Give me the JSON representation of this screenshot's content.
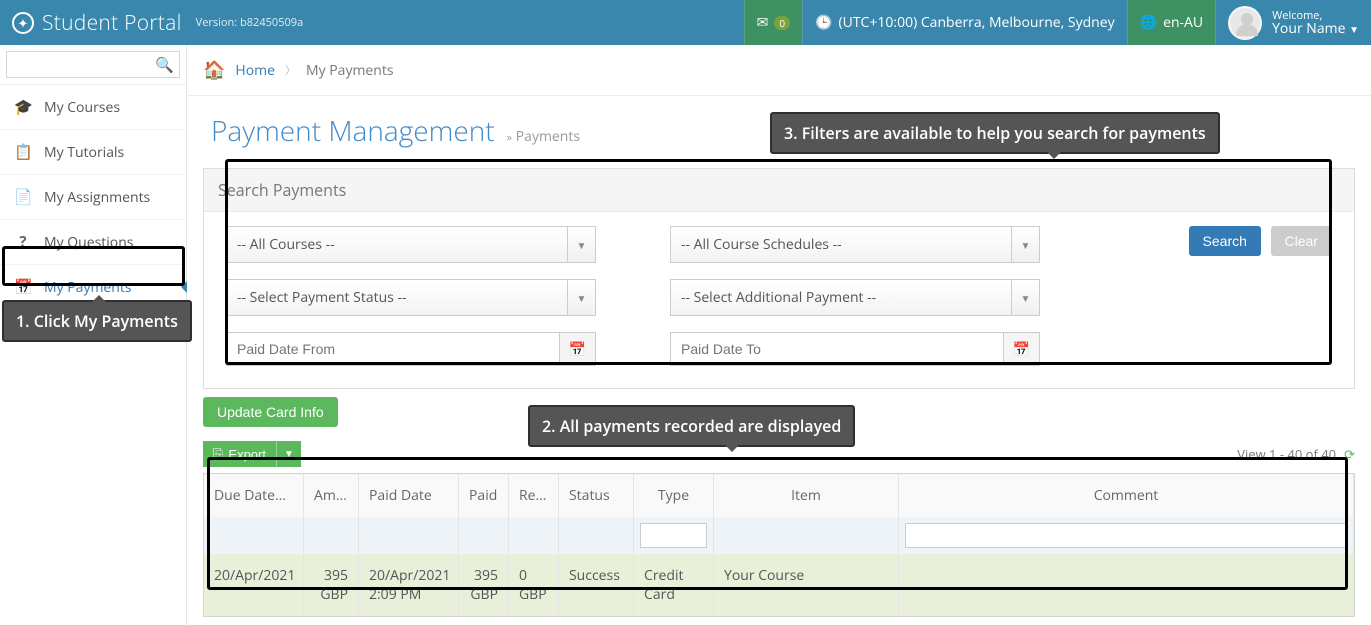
{
  "topbar": {
    "brand": "Student Portal",
    "version": "Version: b82450509a",
    "mail_badge": "0",
    "timezone": "(UTC+10:00) Canberra, Melbourne, Sydney",
    "locale": "en-AU",
    "welcome_label": "Welcome,",
    "user_name": "Your Name"
  },
  "sidebar": {
    "search_placeholder": "",
    "items": [
      {
        "label": "My Courses"
      },
      {
        "label": "My Tutorials"
      },
      {
        "label": "My Assignments"
      },
      {
        "label": "My Questions"
      },
      {
        "label": "My Payments"
      }
    ]
  },
  "crumbs": {
    "home": "Home",
    "current": "My Payments"
  },
  "page": {
    "title": "Payment Management",
    "sub": "Payments"
  },
  "search_panel": {
    "title": "Search Payments",
    "courses": "-- All Courses --",
    "schedules": "-- All Course Schedules --",
    "status": "-- Select Payment Status --",
    "additional": "-- Select Additional Payment --",
    "paid_from_ph": "Paid Date From",
    "paid_to_ph": "Paid Date To",
    "search_btn": "Search",
    "clear_btn": "Clear"
  },
  "actions": {
    "update_card": "Update Card Info",
    "export": "Export",
    "view_text": "View 1 - 40 of 40"
  },
  "grid": {
    "headers": {
      "due": "Due Date",
      "amount": "Amount",
      "paid_date": "Paid Date",
      "paid": "Paid",
      "remain": "Remain",
      "status": "Status",
      "type": "Type",
      "item": "Item",
      "comment": "Comment"
    },
    "rows": [
      {
        "due": "20/Apr/2021",
        "amount": "395 GBP",
        "paid_date": "20/Apr/2021 2:09 PM",
        "paid": "395 GBP",
        "remain": "0 GBP",
        "status": "Success",
        "type": "Credit Card",
        "item": "Your Course",
        "comment": ""
      }
    ]
  },
  "callouts": {
    "c1": "1. Click My Payments",
    "c2": "2. All payments recorded are displayed",
    "c3": "3. Filters are available to help you search for payments"
  }
}
